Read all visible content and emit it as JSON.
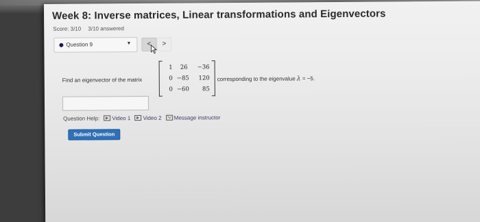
{
  "header": {
    "title": "Week 8: Inverse matrices, Linear transformations and Eigenvectors",
    "score": "Score: 3/10",
    "answered": "3/10 answered"
  },
  "question_nav": {
    "selected": "Question 9",
    "prev_label": "<",
    "next_label": ">"
  },
  "problem": {
    "prompt": "Find an eigenvector of the matrix",
    "matrix": [
      [
        "1",
        "26",
        "−36"
      ],
      [
        "0",
        "−85",
        "120"
      ],
      [
        "0",
        "−60",
        "85"
      ]
    ],
    "suffix_text": "corresponding to the eigenvalue",
    "lambda_symbol": "λ",
    "equals": "=",
    "eigenvalue": "−5."
  },
  "answer": {
    "value": ""
  },
  "help": {
    "label": "Question Help:",
    "video1": "Video 1",
    "video2": "Video 2",
    "message": "Message instructor"
  },
  "submit_label": "Submit Question",
  "colors": {
    "submit": "#2f70b6",
    "status_dot": "#1a1a5a"
  }
}
